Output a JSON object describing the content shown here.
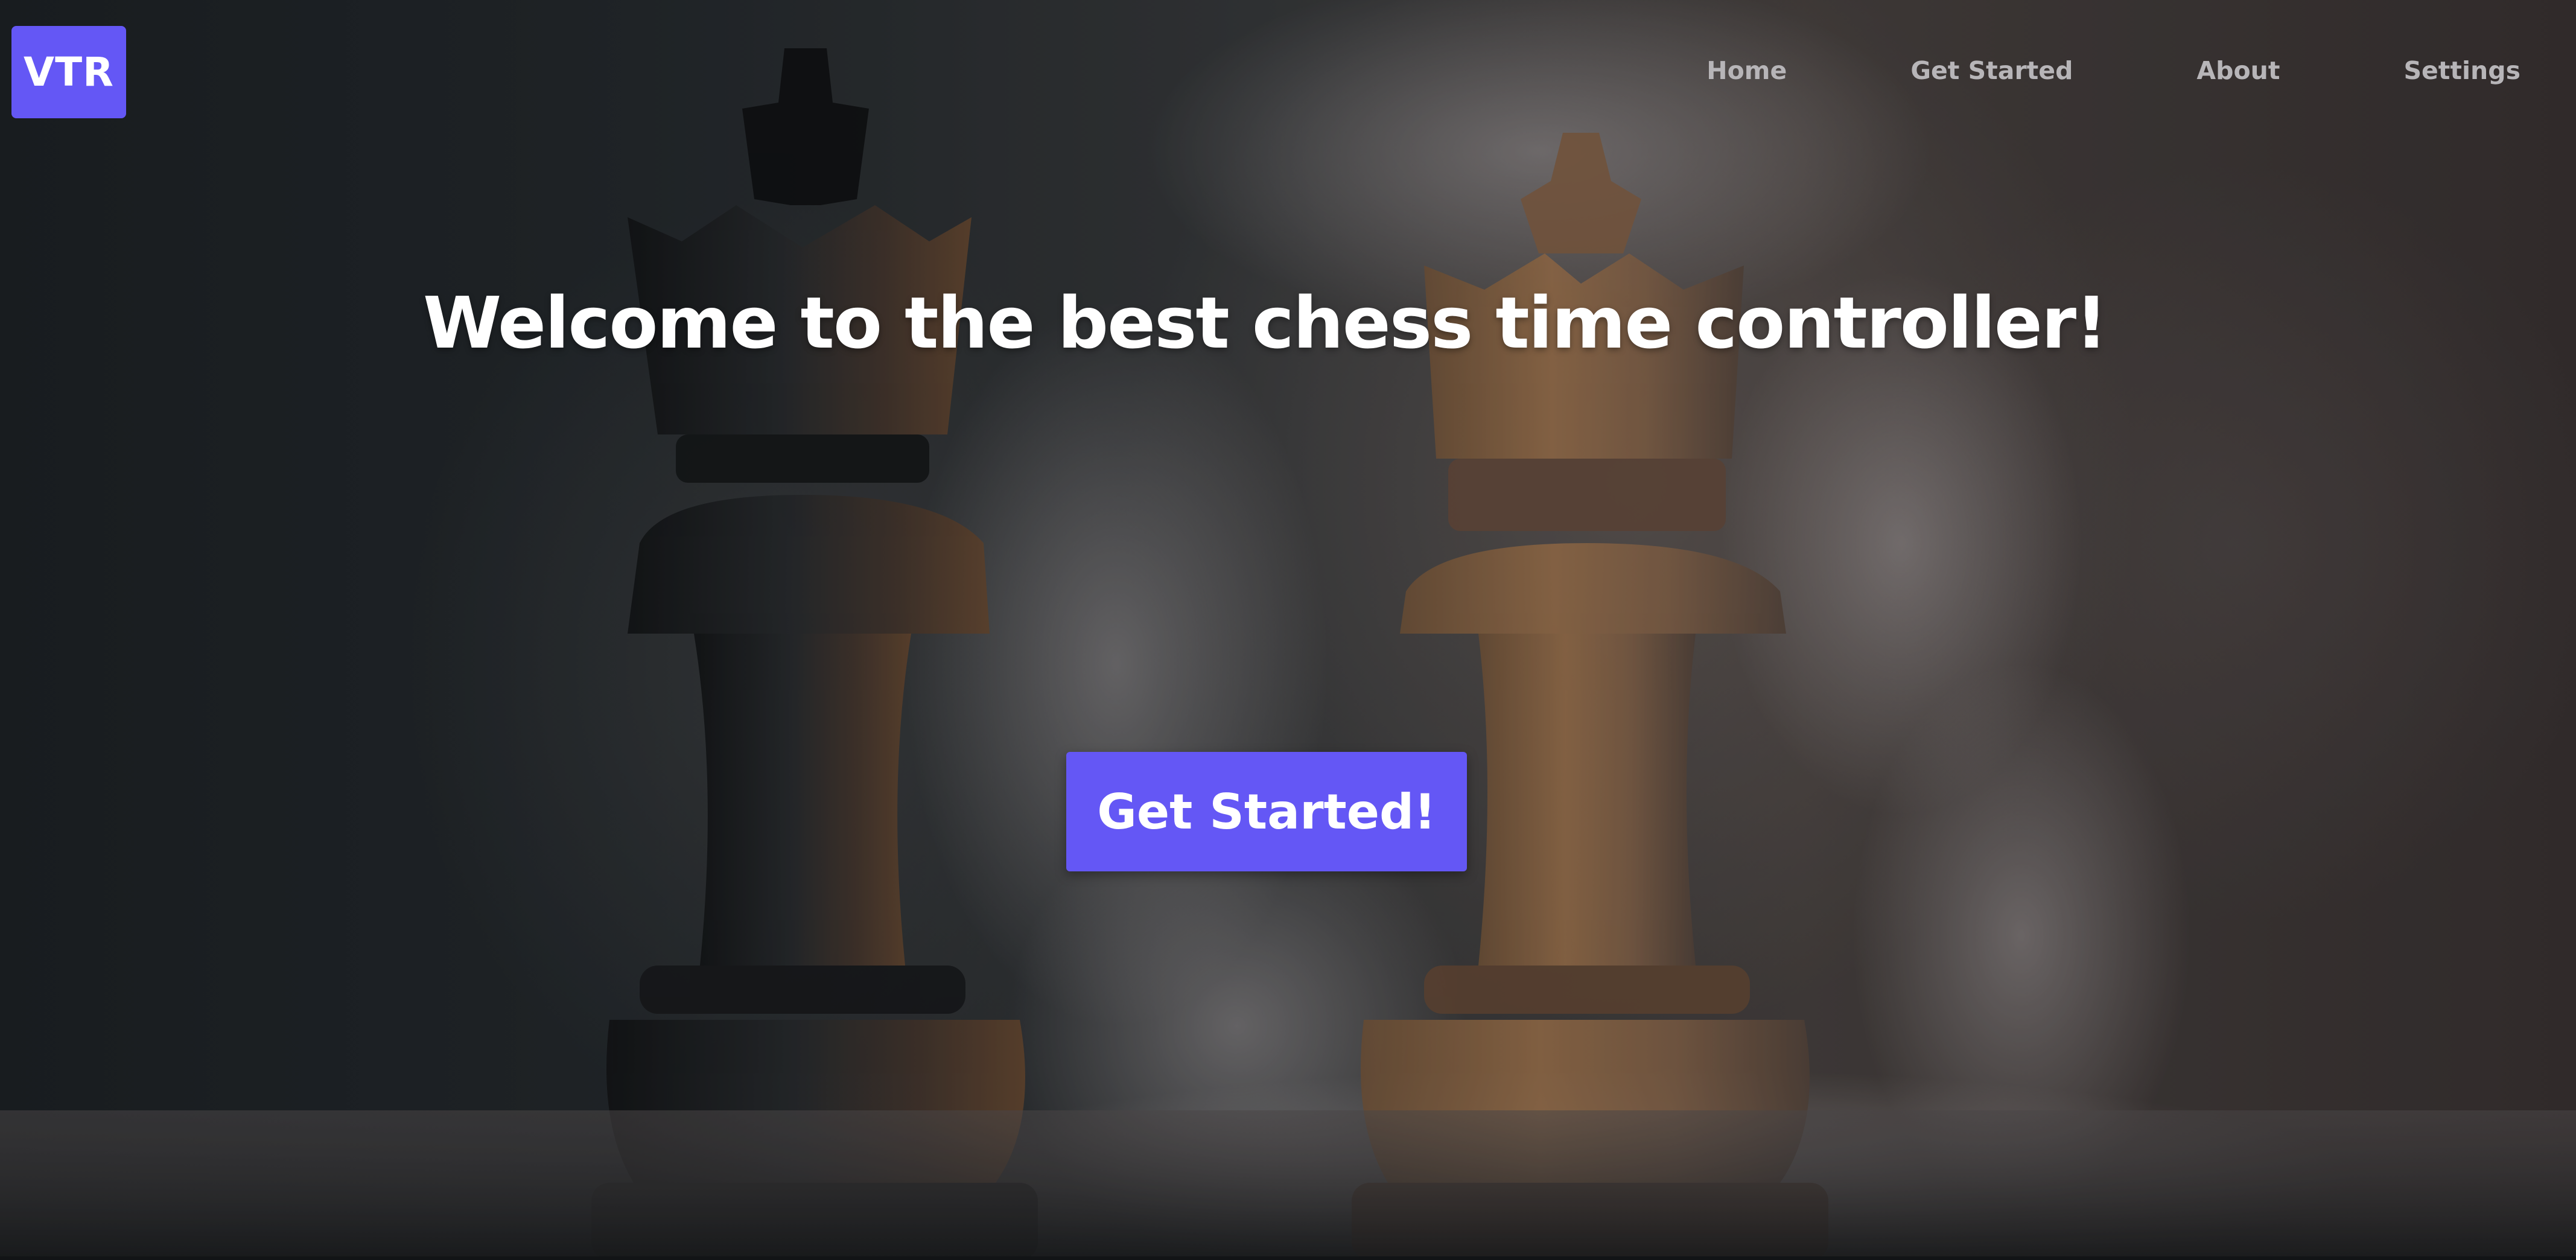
{
  "logo": {
    "text": "VTR"
  },
  "nav": {
    "items": [
      {
        "label": "Home"
      },
      {
        "label": "Get Started"
      },
      {
        "label": "About"
      },
      {
        "label": "Settings"
      }
    ]
  },
  "hero": {
    "headline": "Welcome to the best chess time controller!",
    "cta_label": "Get Started!",
    "background_image": "chess-kings-with-smoke"
  },
  "colors": {
    "accent": "#6457f5",
    "nav_text": "#b7b5b8",
    "headline": "#ffffff"
  }
}
